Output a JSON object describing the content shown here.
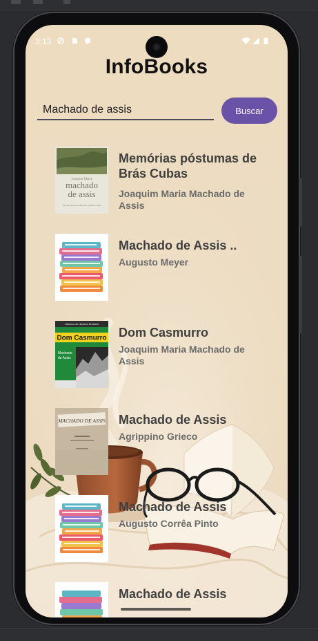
{
  "status_bar": {
    "time": "3:13"
  },
  "app": {
    "title": "InfoBooks"
  },
  "search": {
    "value": "Machado de assis",
    "button_label": "Buscar"
  },
  "books": [
    {
      "title": "Memórias póstumas de Brás Cubas",
      "author": "Joaquim Maria Machado de Assis"
    },
    {
      "title": "Machado de Assis ..",
      "author": "Augusto Meyer"
    },
    {
      "title": "Dom Casmurro",
      "author": "Joaquim Maria Machado de Assis"
    },
    {
      "title": "Machado de Assis",
      "author": "Agrippino Grieco"
    },
    {
      "title": "Machado de Assis",
      "author": "Augusto Corrêa Pinto"
    },
    {
      "title": "Machado de Assis",
      "author": ""
    }
  ],
  "covers": {
    "memorias": {
      "line1": "Joaquim Maria",
      "line2": "machado",
      "line3": "de assis",
      "subtitle": "The Posthumous Memoirs of Brás Cubas"
    },
    "dom_casmurro": {
      "header": "Clássicos da Literatura Brasileira",
      "title": "Dom Casmurro",
      "author_line1": "Machado",
      "author_line2": "de Assis"
    },
    "grieco": {
      "title": "MACHADO DE ASSIS"
    }
  },
  "colors": {
    "accent": "#6a52a8",
    "background": "#eddcc0"
  }
}
